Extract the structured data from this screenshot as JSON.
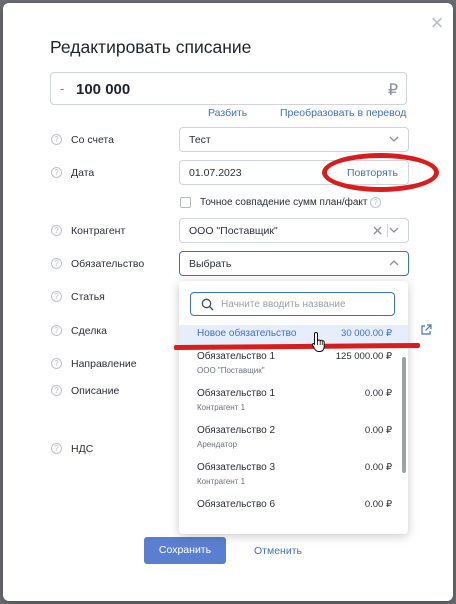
{
  "dialog": {
    "title": "Редактировать списание",
    "close_icon": "close-icon"
  },
  "amount": {
    "sign": "-",
    "value": "100 000",
    "currency": "₽"
  },
  "links": {
    "split": "Разбить",
    "convert": "Преобразовать в перевод"
  },
  "fields": {
    "account": {
      "label": "Со счета",
      "value": "Тест"
    },
    "date": {
      "label": "Дата",
      "value": "01.07.2023",
      "repeat": "Повторять"
    },
    "exact_match": {
      "label": "Точное совпадение сумм план/факт",
      "checked": false
    },
    "counterparty": {
      "label": "Контрагент",
      "value": "ООО \"Поставщик\""
    },
    "obligation": {
      "label": "Обязательство",
      "value": "Выбрать"
    },
    "article": {
      "label": "Статья"
    },
    "deal": {
      "label": "Сделка"
    },
    "direction": {
      "label": "Направление"
    },
    "description": {
      "label": "Описание"
    },
    "vat": {
      "label": "НДС"
    }
  },
  "dropdown": {
    "search_placeholder": "Начните вводить название",
    "items": [
      {
        "name": "Новое обязательство",
        "amount": "30 000.00 ₽",
        "sub": ""
      },
      {
        "name": "Обязательство 1",
        "amount": "125 000.00 ₽",
        "sub": "ООО \"Поставщик\""
      },
      {
        "name": "Обязательство 1",
        "amount": "0.00 ₽",
        "sub": "Контрагент 1"
      },
      {
        "name": "Обязательство 2",
        "amount": "0.00 ₽",
        "sub": "Арендатор"
      },
      {
        "name": "Обязательство 3",
        "amount": "0.00 ₽",
        "sub": "Контрагент 1"
      },
      {
        "name": "Обязательство 6",
        "amount": "0.00 ₽",
        "sub": ""
      }
    ]
  },
  "buttons": {
    "save": "Сохранить",
    "cancel": "Отменить"
  },
  "colors": {
    "accent": "#3b6fc9",
    "primary_button": "#5b7fd0",
    "annotation": "#d91c1c",
    "highlight_row": "#e6eefb"
  }
}
